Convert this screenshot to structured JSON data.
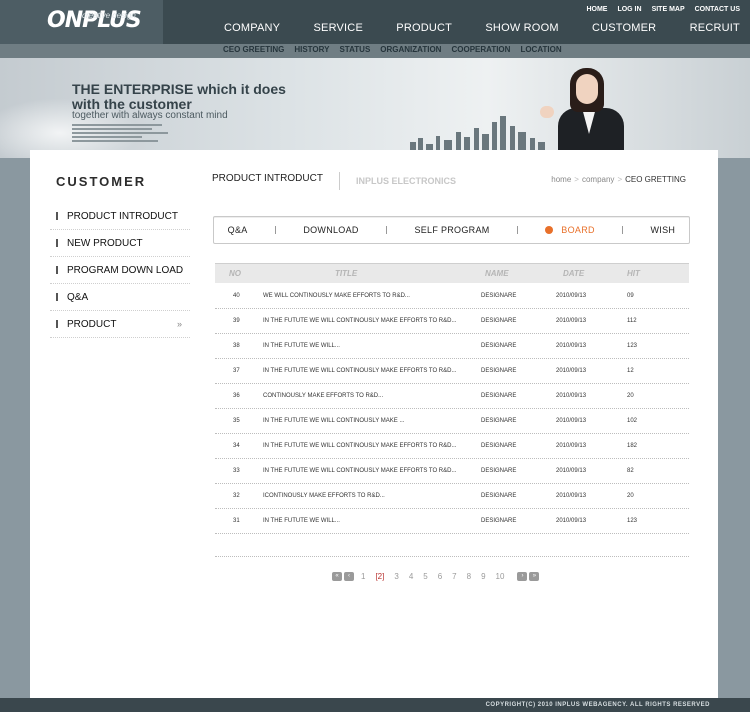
{
  "brand": {
    "logo": "ONPLUS",
    "tagline": "creative design"
  },
  "util_links": [
    "HOME",
    "LOG IN",
    "SITE MAP",
    "CONTACT US"
  ],
  "main_nav": [
    "COMPANY",
    "SERVICE",
    "PRODUCT",
    "SHOW ROOM",
    "CUSTOMER",
    "RECRUIT"
  ],
  "sub_nav": [
    "CEO GREETING",
    "HISTORY",
    "STATUS",
    "ORGANIZATION",
    "COOPERATION",
    "LOCATION"
  ],
  "hero": {
    "line1": "THE ENTERPRISE which it does",
    "line2": "with the customer",
    "line3": "together with always constant mind"
  },
  "sidebar": {
    "title": "CUSTOMER",
    "items": [
      {
        "label": "PRODUCT INTRODUCT"
      },
      {
        "label": "NEW PRODUCT"
      },
      {
        "label": "PROGRAM DOWN LOAD"
      },
      {
        "label": "Q&A"
      },
      {
        "label": "PRODUCT",
        "arrow": "»"
      }
    ]
  },
  "content_tabs": {
    "active": "PRODUCT INTRODUCT",
    "inactive": "INPLUS ELECTRONICS"
  },
  "breadcrumb": {
    "home": "home",
    "section": "company",
    "current": "CEO GRETTING",
    "sep": ">"
  },
  "board_tabs": [
    "Q&A",
    "DOWNLOAD",
    "SELF PROGRAM",
    "BOARD",
    "WISH"
  ],
  "table": {
    "headers": {
      "no": "NO",
      "title": "TITLE",
      "name": "NAME",
      "date": "DATE",
      "hit": "HIT"
    },
    "rows": [
      {
        "no": "40",
        "title": "WE WILL CONTINOUSLY MAKE EFFORTS TO R&D...",
        "name": "DESIGNARE",
        "date": "2010/09/13",
        "hit": "09"
      },
      {
        "no": "39",
        "title": "IN THE FUTUTE WE WILL CONTINOUSLY MAKE EFFORTS TO R&D...",
        "name": "DESIGNARE",
        "date": "2010/09/13",
        "hit": "112"
      },
      {
        "no": "38",
        "title": "IN THE FUTUTE WE WILL...",
        "name": "DESIGNARE",
        "date": "2010/09/13",
        "hit": "123"
      },
      {
        "no": "37",
        "title": "IN THE FUTUTE WE WILL CONTINOUSLY MAKE EFFORTS TO R&D...",
        "name": "DESIGNARE",
        "date": "2010/09/13",
        "hit": "12"
      },
      {
        "no": "36",
        "title": "CONTINOUSLY MAKE EFFORTS TO R&D...",
        "name": "DESIGNARE",
        "date": "2010/09/13",
        "hit": "20"
      },
      {
        "no": "35",
        "title": "IN THE FUTUTE WE WILL CONTINOUSLY MAKE ...",
        "name": "DESIGNARE",
        "date": "2010/09/13",
        "hit": "102"
      },
      {
        "no": "34",
        "title": "IN THE FUTUTE WE WILL CONTINOUSLY MAKE EFFORTS TO R&D...",
        "name": "DESIGNARE",
        "date": "2010/09/13",
        "hit": "182"
      },
      {
        "no": "33",
        "title": "IN THE FUTUTE WE WILL CONTINOUSLY MAKE EFFORTS TO R&D...",
        "name": "DESIGNARE",
        "date": "2010/09/13",
        "hit": "82"
      },
      {
        "no": "32",
        "title": "ICONTINOUSLY MAKE EFFORTS TO R&D...",
        "name": "DESIGNARE",
        "date": "2010/09/13",
        "hit": "20"
      },
      {
        "no": "31",
        "title": "IN THE FUTUTE WE WILL...",
        "name": "DESIGNARE",
        "date": "2010/09/13",
        "hit": "123"
      }
    ]
  },
  "pagination": {
    "first": "«",
    "prev": "‹",
    "current": "[2]",
    "pages": [
      "1",
      "[2]",
      "3",
      "4",
      "5",
      "6",
      "7",
      "8",
      "9",
      "10"
    ],
    "next": "›",
    "last": "»"
  },
  "footer": {
    "copyright": "COPYRIGHT(C) 2010 INPLUS WEBAGENCY. ALL RIGHTS RESERVED"
  },
  "colors": {
    "accent": "#e8702a",
    "current_page": "#b8322f",
    "topbar": "#3b4a50"
  }
}
